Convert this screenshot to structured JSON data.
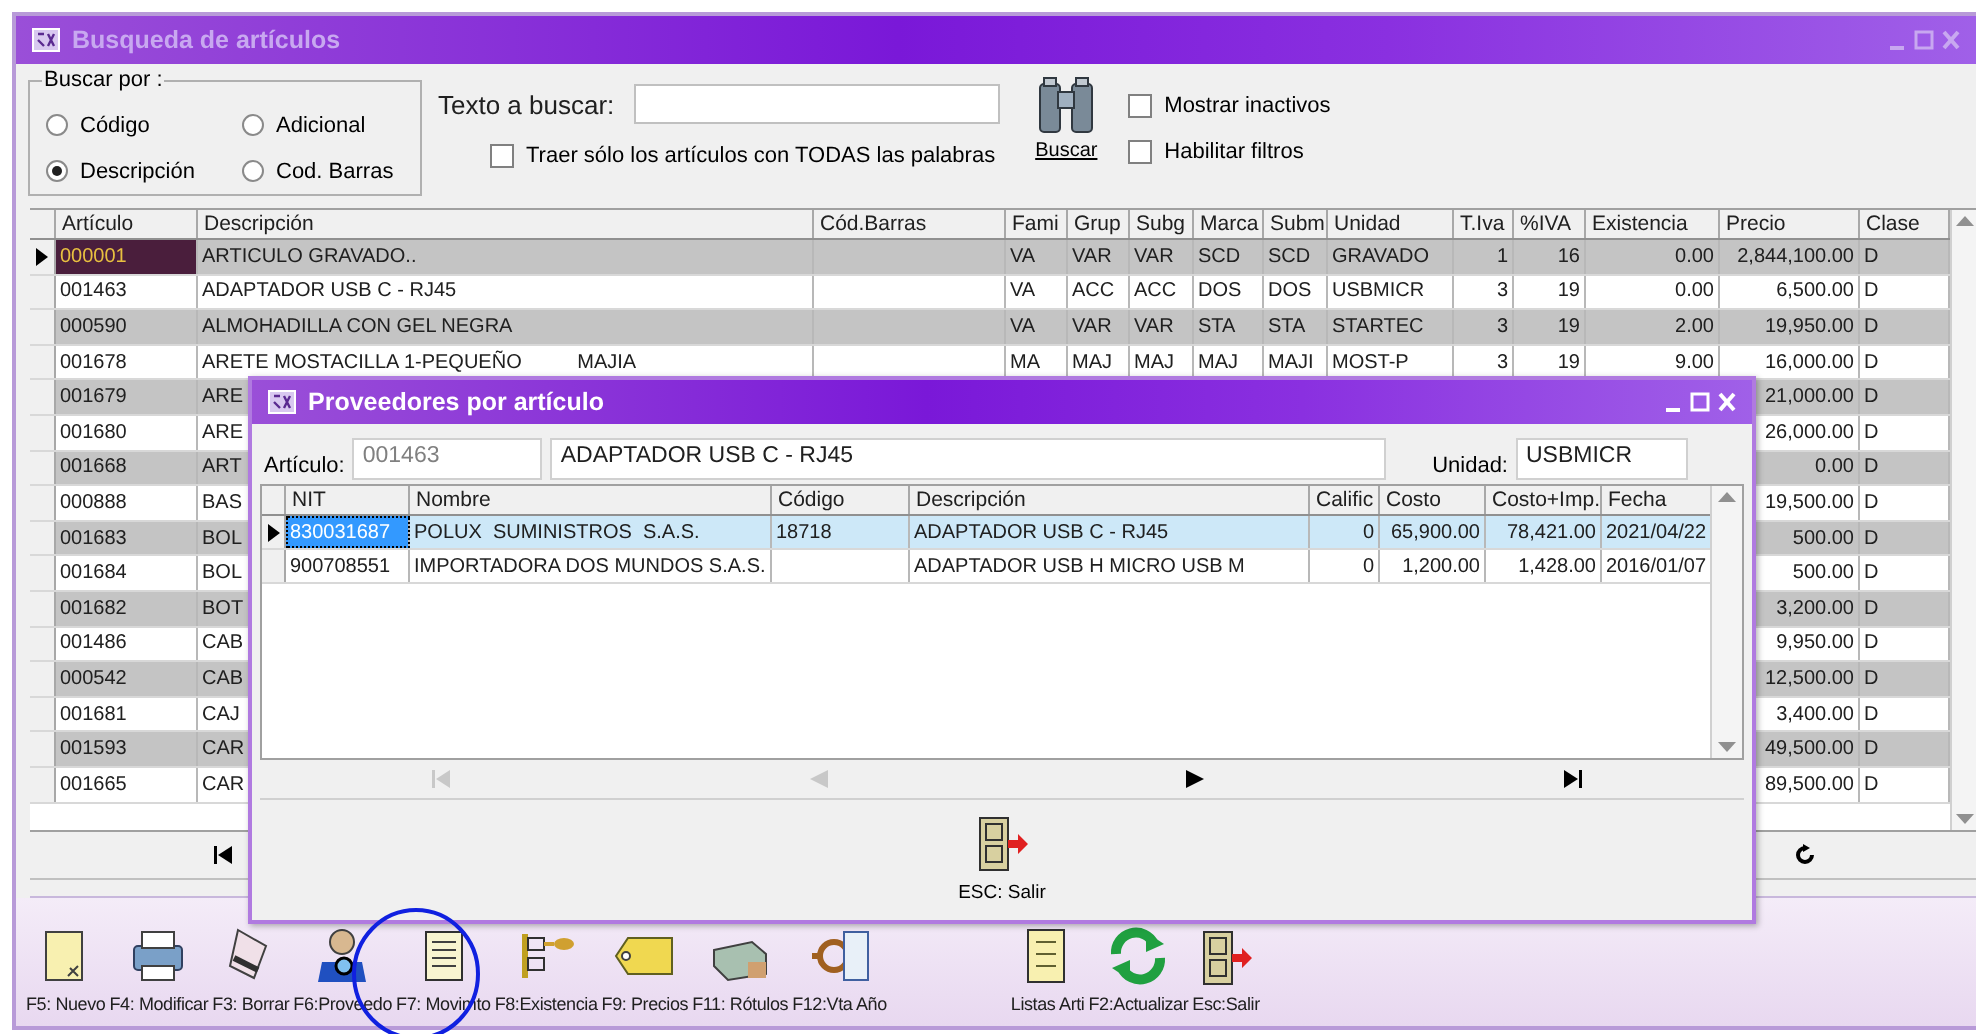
{
  "window": {
    "title": "Busqueda de artículos"
  },
  "search": {
    "group_title": "Buscar por :",
    "options": [
      {
        "label": "Código",
        "selected": false
      },
      {
        "label": "Adicional",
        "selected": false
      },
      {
        "label": "Descripción",
        "selected": true
      },
      {
        "label": "Cod. Barras",
        "selected": false
      }
    ],
    "text_label": "Texto a buscar:",
    "all_words": {
      "label": "Traer sólo los artículos con TODAS las palabras",
      "checked": false
    },
    "search_button": "Buscar",
    "filters": [
      {
        "label": "Mostrar inactivos",
        "checked": false
      },
      {
        "label": "Habilitar filtros",
        "checked": false
      }
    ]
  },
  "grid": {
    "columns": [
      "Artículo",
      "Descripción",
      "Cód.Barras",
      "Fami",
      "Grup",
      "Subg",
      "Marca",
      "Subm",
      "Unidad",
      "T.Iva",
      "%IVA",
      "Existencia",
      "Precio",
      "Clase"
    ],
    "rows": [
      {
        "selected": true,
        "articulo": "000001",
        "descripcion": "ARTICULO GRAVADO..",
        "fami": "VA",
        "grupo": "VAR",
        "subg": "VAR",
        "marca": "SCD",
        "subm": "SCD",
        "unidad": "GRAVADO",
        "t_iva": "1",
        "iva": "16",
        "existencia": "0.00",
        "precio": "2,844,100.00",
        "clase": "D"
      },
      {
        "selected": false,
        "articulo": "001463",
        "descripcion": "ADAPTADOR USB C - RJ45",
        "fami": "VA",
        "grupo": "ACC",
        "subg": "ACC",
        "marca": "DOS",
        "subm": "DOS",
        "unidad": "USBMICR",
        "t_iva": "3",
        "iva": "19",
        "existencia": "0.00",
        "precio": "6,500.00",
        "clase": "D"
      },
      {
        "selected": false,
        "articulo": "000590",
        "descripcion": "ALMOHADILLA CON GEL NEGRA",
        "fami": "VA",
        "grupo": "VAR",
        "subg": "VAR",
        "marca": "STA",
        "subm": "STA",
        "unidad": "STARTEC",
        "t_iva": "3",
        "iva": "19",
        "existencia": "2.00",
        "precio": "19,950.00",
        "clase": "D"
      },
      {
        "selected": false,
        "articulo": "001678",
        "descripcion": "ARETE MOSTACILLA 1-PEQUEÑO          MAJIA",
        "fami": "MA",
        "grupo": "MAJ",
        "subg": "MAJ",
        "marca": "MAJ",
        "subm": "MAJI",
        "unidad": "MOST-P",
        "t_iva": "3",
        "iva": "19",
        "existencia": "9.00",
        "precio": "16,000.00",
        "clase": "D"
      },
      {
        "selected": false,
        "articulo": "001679",
        "descripcion": "ARE",
        "precio": "21,000.00",
        "clase": "D"
      },
      {
        "selected": false,
        "articulo": "001680",
        "descripcion": "ARE",
        "precio": "26,000.00",
        "clase": "D"
      },
      {
        "selected": false,
        "articulo": "001668",
        "descripcion": "ART",
        "precio": "0.00",
        "clase": "D"
      },
      {
        "selected": false,
        "articulo": "000888",
        "descripcion": "BAS",
        "precio": "19,500.00",
        "clase": "D"
      },
      {
        "selected": false,
        "articulo": "001683",
        "descripcion": "BOL",
        "precio": "500.00",
        "clase": "D"
      },
      {
        "selected": false,
        "articulo": "001684",
        "descripcion": "BOL",
        "precio": "500.00",
        "clase": "D"
      },
      {
        "selected": false,
        "articulo": "001682",
        "descripcion": "BOT",
        "precio": "3,200.00",
        "clase": "D"
      },
      {
        "selected": false,
        "articulo": "001486",
        "descripcion": "CAB",
        "precio": "9,950.00",
        "clase": "D"
      },
      {
        "selected": false,
        "articulo": "000542",
        "descripcion": "CAB",
        "precio": "12,500.00",
        "clase": "D"
      },
      {
        "selected": false,
        "articulo": "001681",
        "descripcion": "CAJ",
        "precio": "3,400.00",
        "clase": "D"
      },
      {
        "selected": false,
        "articulo": "001593",
        "descripcion": "CAR",
        "precio": "49,500.00",
        "clase": "D"
      },
      {
        "selected": false,
        "articulo": "001665",
        "descripcion": "CAR",
        "precio": "89,500.00",
        "clase": "D"
      }
    ]
  },
  "dialog": {
    "title": "Proveedores por artículo",
    "articulo_label": "Artículo:",
    "articulo_code": "001463",
    "articulo_description": "ADAPTADOR USB C - RJ45",
    "unidad_label": "Unidad:",
    "unidad": "USBMICR",
    "columns": [
      "NIT",
      "Nombre",
      "Código",
      "Descripción",
      "Calific",
      "Costo",
      "Costo+Imp.",
      "Fecha"
    ],
    "rows": [
      {
        "selected": true,
        "nit": "830031687",
        "nombre": "POLUX  SUMINISTROS  S.A.S.",
        "codigo": "18718",
        "descripcion": "ADAPTADOR USB C - RJ45",
        "califica": "0",
        "costo": "65,900.00",
        "costo_imp": "78,421.00",
        "fecha": "2021/04/22"
      },
      {
        "selected": false,
        "nit": "900708551",
        "nombre": "IMPORTADORA DOS MUNDOS S.A.S.",
        "descripcion": "ADAPTADOR USB H MICRO USB M",
        "califica": "0",
        "costo": "1,200.00",
        "costo_imp": "1,428.00",
        "fecha": "2016/01/07"
      }
    ],
    "navigator": [
      {
        "disabled": true
      },
      {
        "disabled": true
      },
      {
        "disabled": false
      },
      {
        "disabled": false
      }
    ],
    "exit_button": "ESC: Salir"
  },
  "toolbar": {
    "items": [
      "F5: Nuevo",
      "F4: Modificar",
      "F3: Borrar",
      "F6:Proveedo",
      "F7: Movimto",
      "F8:Existencia",
      "F9: Precios",
      "F11: Rótulos",
      "F12:Vta Año"
    ],
    "extra_items": [
      "Listas Arti",
      "F2:Actualizar",
      "Esc:Salir"
    ]
  }
}
